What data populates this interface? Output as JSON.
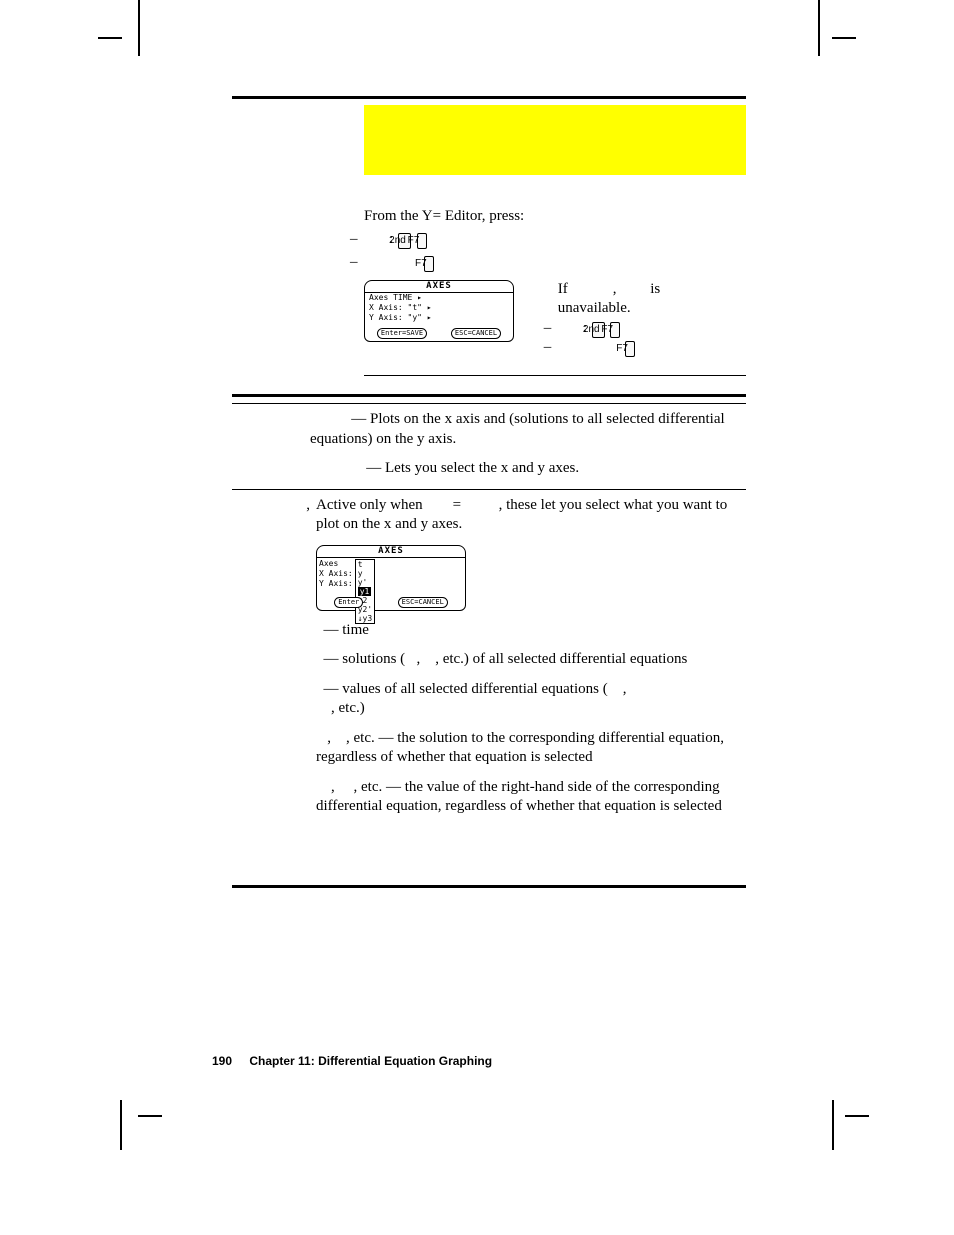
{
  "body": {
    "intro": "From the Y= Editor, press:",
    "colon": ":"
  },
  "keys": {
    "second": "2nd",
    "f7": "F7"
  },
  "note": {
    "l1a": "If",
    "l1b": "is",
    "l2": "unavailable."
  },
  "shot1": {
    "title": "AXES",
    "r1": "Axes   TIME ▸",
    "r2": "X Axis: \"t\" ▸",
    "r3": "Y Axis: \"y\" ▸",
    "b1": "Enter=SAVE",
    "b2": "ESC=CANCEL"
  },
  "shot2": {
    "title": "AXES",
    "l1": "Axes",
    "l2": "X Axis:",
    "l3": "Y Axis:",
    "m1": "t",
    "m2": "y",
    "m3": "y'",
    "m4": "y1",
    "m5": "y2",
    "m6": "y2'",
    "m7": "↓y3",
    "b1": "Enter",
    "b2": "ESC=CANCEL"
  },
  "items": {
    "time1": "— Plots   on the x axis and   (solutions to all selected differential equations) on the y axis.",
    "custom1": "— Lets you select the x and y axes.",
    "xy1a": "Active only when",
    "xy1b": ", these let you select what you want to plot on the x and y axes.",
    "t": "— time",
    "y_a": "— solutions (",
    "y_b": ", etc.) of all selected differential equations",
    "yp_a": "— values of all selected differential equations (",
    "yp_b": ", etc.)",
    "yn": ", etc. — the solution to the corresponding differential equation, regardless of whether that equation is selected",
    "ynp": ", etc. — the value of the right-hand side of the corresponding differential equation, regardless of whether that equation is selected"
  },
  "footer": {
    "page": "190",
    "chapter": "Chapter 11: Differential Equation Graphing"
  }
}
